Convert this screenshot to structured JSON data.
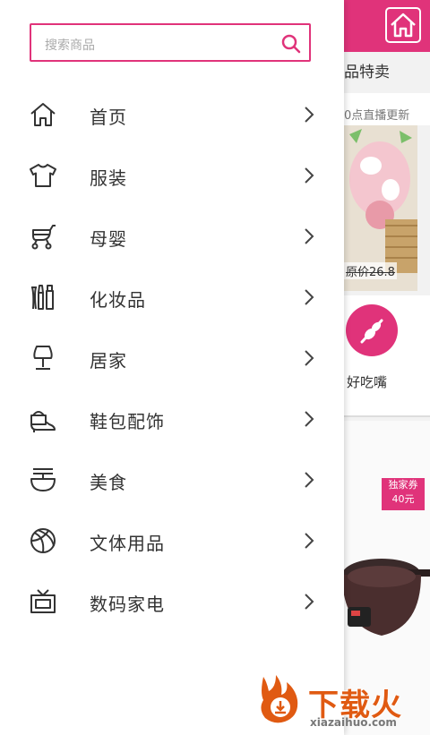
{
  "search": {
    "placeholder": "搜索商品"
  },
  "menu": [
    {
      "label": "首页",
      "icon": "home-icon"
    },
    {
      "label": "服装",
      "icon": "tshirt-icon"
    },
    {
      "label": "母婴",
      "icon": "stroller-icon"
    },
    {
      "label": "化妆品",
      "icon": "cosmetics-icon"
    },
    {
      "label": "居家",
      "icon": "lamp-icon"
    },
    {
      "label": "鞋包配饰",
      "icon": "shoe-icon"
    },
    {
      "label": "美食",
      "icon": "noodle-bowl-icon"
    },
    {
      "label": "文体用品",
      "icon": "ball-icon"
    },
    {
      "label": "数码家电",
      "icon": "tv-icon"
    }
  ],
  "background": {
    "section_title": "品特卖",
    "subtitle": "0点直播更新",
    "price": "原价26.8",
    "category_label": "好吃嘴",
    "coupon_title": "独家券",
    "coupon_value": "40元"
  },
  "watermark": {
    "title": "下载火",
    "url": "xiazaihuo.com"
  },
  "colors": {
    "accent": "#e0337a",
    "text": "#333333",
    "watermark": "#e05a12"
  }
}
